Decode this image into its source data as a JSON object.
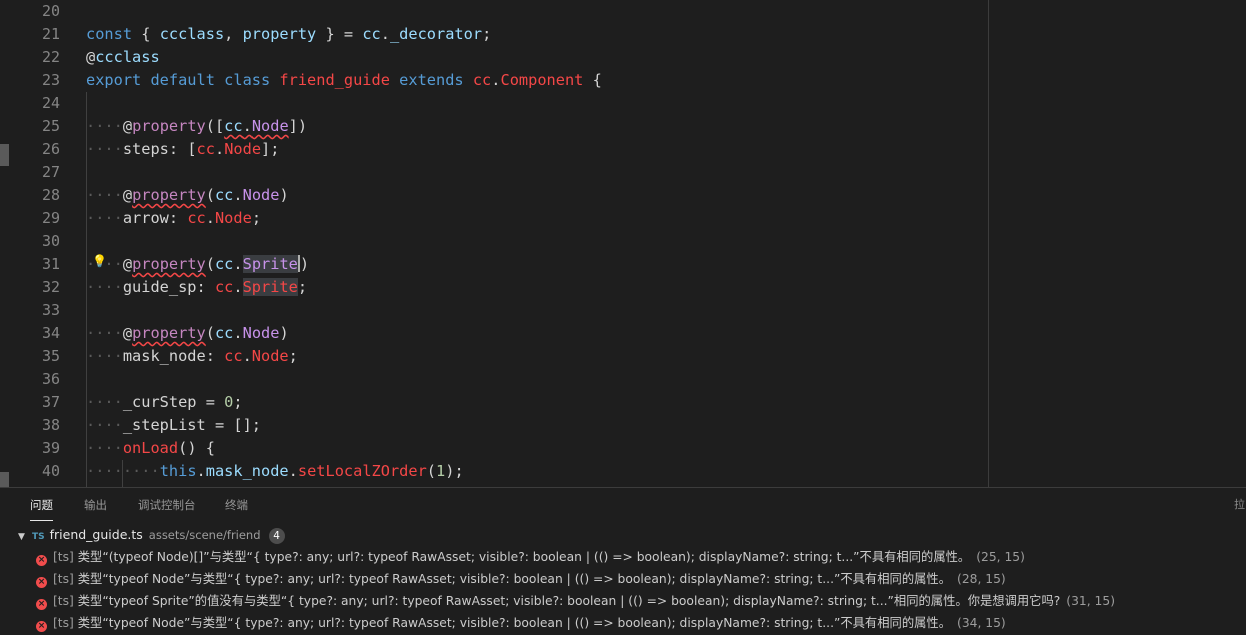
{
  "editor": {
    "line_numbers": [
      "20",
      "21",
      "22",
      "23",
      "24",
      "25",
      "26",
      "27",
      "28",
      "29",
      "30",
      "31",
      "32",
      "33",
      "34",
      "35",
      "36",
      "37",
      "38",
      "39",
      "40"
    ],
    "lines": [
      [],
      [
        {
          "t": "const ",
          "c": "k"
        },
        {
          "t": "{ ",
          "c": "p"
        },
        {
          "t": "ccclass",
          "c": "v"
        },
        {
          "t": ", ",
          "c": "p"
        },
        {
          "t": "property",
          "c": "v"
        },
        {
          "t": " } = ",
          "c": "p"
        },
        {
          "t": "cc",
          "c": "v"
        },
        {
          "t": ".",
          "c": "p"
        },
        {
          "t": "_decorator",
          "c": "v"
        },
        {
          "t": ";",
          "c": "p"
        }
      ],
      [
        {
          "t": "@",
          "c": "p"
        },
        {
          "t": "ccclass",
          "c": "v"
        }
      ],
      [
        {
          "t": "export ",
          "c": "k"
        },
        {
          "t": "default ",
          "c": "k"
        },
        {
          "t": "class ",
          "c": "k"
        },
        {
          "t": "friend_guide ",
          "c": "cls"
        },
        {
          "t": "extends ",
          "c": "k"
        },
        {
          "t": "cc",
          "c": "cls"
        },
        {
          "t": ".",
          "c": "p"
        },
        {
          "t": "Component",
          "c": "cls"
        },
        {
          "t": " {",
          "c": "p"
        }
      ],
      [],
      [
        {
          "t": "····",
          "c": "dots"
        },
        {
          "t": "@",
          "c": "p"
        },
        {
          "t": "property",
          "c": "dec"
        },
        {
          "t": "([",
          "c": "p"
        },
        {
          "t": "cc",
          "c": "v sq"
        },
        {
          "t": ".",
          "c": "p sq"
        },
        {
          "t": "Node",
          "c": "pr sq"
        },
        {
          "t": "])",
          "c": "p"
        }
      ],
      [
        {
          "t": "····",
          "c": "dots"
        },
        {
          "t": "steps",
          "c": "p"
        },
        {
          "t": ": [",
          "c": "p"
        },
        {
          "t": "cc",
          "c": "cls"
        },
        {
          "t": ".",
          "c": "p"
        },
        {
          "t": "Node",
          "c": "cls"
        },
        {
          "t": "];",
          "c": "p"
        }
      ],
      [],
      [
        {
          "t": "····",
          "c": "dots"
        },
        {
          "t": "@",
          "c": "p"
        },
        {
          "t": "property",
          "c": "dec sq"
        },
        {
          "t": "(",
          "c": "p"
        },
        {
          "t": "cc",
          "c": "v"
        },
        {
          "t": ".",
          "c": "p"
        },
        {
          "t": "Node",
          "c": "pr"
        },
        {
          "t": ")",
          "c": "p"
        }
      ],
      [
        {
          "t": "····",
          "c": "dots"
        },
        {
          "t": "arrow",
          "c": "p"
        },
        {
          "t": ": ",
          "c": "p"
        },
        {
          "t": "cc",
          "c": "cls"
        },
        {
          "t": ".",
          "c": "p"
        },
        {
          "t": "Node",
          "c": "cls"
        },
        {
          "t": ";",
          "c": "p"
        }
      ],
      [],
      [
        {
          "t": "····",
          "c": "dots"
        },
        {
          "t": "@",
          "c": "p"
        },
        {
          "t": "property",
          "c": "dec sq"
        },
        {
          "t": "(",
          "c": "p"
        },
        {
          "t": "cc",
          "c": "v"
        },
        {
          "t": ".",
          "c": "p"
        },
        {
          "t": "Sprite",
          "c": "pr sel"
        },
        {
          "t": "|",
          "c": "cursor"
        },
        {
          "t": ")",
          "c": "p"
        }
      ],
      [
        {
          "t": "····",
          "c": "dots"
        },
        {
          "t": "guide_sp",
          "c": "p"
        },
        {
          "t": ": ",
          "c": "p"
        },
        {
          "t": "cc",
          "c": "cls"
        },
        {
          "t": ".",
          "c": "p"
        },
        {
          "t": "Sprite",
          "c": "cls sel"
        },
        {
          "t": ";",
          "c": "p"
        }
      ],
      [],
      [
        {
          "t": "····",
          "c": "dots"
        },
        {
          "t": "@",
          "c": "p"
        },
        {
          "t": "property",
          "c": "dec sq"
        },
        {
          "t": "(",
          "c": "p"
        },
        {
          "t": "cc",
          "c": "v"
        },
        {
          "t": ".",
          "c": "p"
        },
        {
          "t": "Node",
          "c": "pr"
        },
        {
          "t": ")",
          "c": "p"
        }
      ],
      [
        {
          "t": "····",
          "c": "dots"
        },
        {
          "t": "mask_node",
          "c": "p"
        },
        {
          "t": ": ",
          "c": "p"
        },
        {
          "t": "cc",
          "c": "cls"
        },
        {
          "t": ".",
          "c": "p"
        },
        {
          "t": "Node",
          "c": "cls"
        },
        {
          "t": ";",
          "c": "p"
        }
      ],
      [],
      [
        {
          "t": "····",
          "c": "dots"
        },
        {
          "t": "_curStep",
          "c": "p"
        },
        {
          "t": " = ",
          "c": "p"
        },
        {
          "t": "0",
          "c": "n"
        },
        {
          "t": ";",
          "c": "p"
        }
      ],
      [
        {
          "t": "····",
          "c": "dots"
        },
        {
          "t": "_stepList",
          "c": "p"
        },
        {
          "t": " = [];",
          "c": "p"
        }
      ],
      [
        {
          "t": "····",
          "c": "dots"
        },
        {
          "t": "onLoad",
          "c": "cls"
        },
        {
          "t": "() {",
          "c": "p"
        }
      ],
      [
        {
          "t": "········",
          "c": "dots"
        },
        {
          "t": "this",
          "c": "k"
        },
        {
          "t": ".",
          "c": "p"
        },
        {
          "t": "mask_node",
          "c": "v"
        },
        {
          "t": ".",
          "c": "p"
        },
        {
          "t": "setLocalZOrder",
          "c": "cls"
        },
        {
          "t": "(",
          "c": "p"
        },
        {
          "t": "1",
          "c": "n"
        },
        {
          "t": ");",
          "c": "p"
        }
      ]
    ]
  },
  "panel": {
    "tabs": [
      "问题",
      "输出",
      "调试控制台",
      "终端"
    ],
    "right_label": "拉",
    "file": {
      "badge": "TS",
      "name": "friend_guide.ts",
      "path": "assets/scene/friend",
      "count": "4"
    },
    "problems": [
      {
        "source": "[ts]",
        "message": "类型“(typeof Node)[]”与类型“{ type?: any; url?: typeof RawAsset; visible?: boolean | (() => boolean); displayName?: string; t...”不具有相同的属性。",
        "position": "(25, 15)"
      },
      {
        "source": "[ts]",
        "message": "类型“typeof Node”与类型“{ type?: any; url?: typeof RawAsset; visible?: boolean | (() => boolean); displayName?: string; t...”不具有相同的属性。",
        "position": "(28, 15)"
      },
      {
        "source": "[ts]",
        "message": "类型“typeof Sprite”的值没有与类型“{ type?: any; url?: typeof RawAsset; visible?: boolean | (() => boolean); displayName?: string; t...”相同的属性。你是想调用它吗?",
        "position": "(31, 15)"
      },
      {
        "source": "[ts]",
        "message": "类型“typeof Node”与类型“{ type?: any; url?: typeof RawAsset; visible?: boolean | (() => boolean); displayName?: string; t...”不具有相同的属性。",
        "position": "(34, 15)"
      }
    ]
  }
}
